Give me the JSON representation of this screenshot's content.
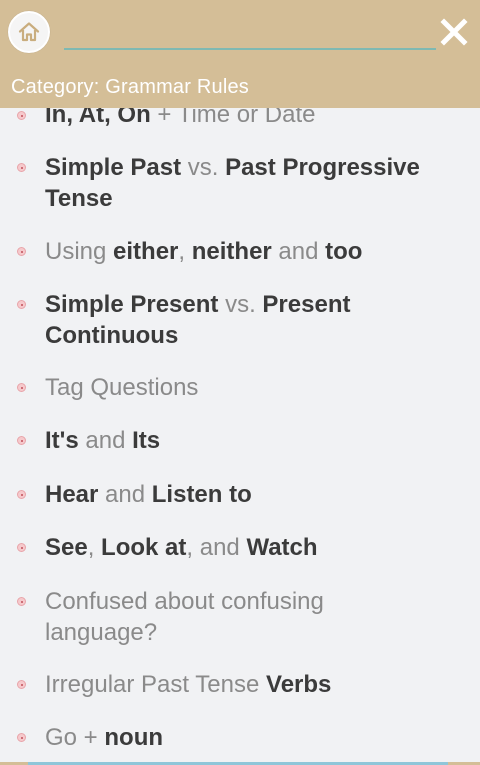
{
  "header": {
    "home_icon": "home-icon",
    "close_icon": "close-icon",
    "search_placeholder": "",
    "category_label": "Category: Grammar Rules",
    "background": "#d4be97"
  },
  "list": {
    "items": [
      {
        "segments": [
          {
            "text": "In, At, On",
            "bold": true
          },
          {
            "text": " + Time or Date",
            "bold": false
          }
        ]
      },
      {
        "segments": [
          {
            "text": "Simple Past",
            "bold": true
          },
          {
            "text": " vs. ",
            "bold": false
          },
          {
            "text": "Past Progressive Tense",
            "bold": true
          }
        ]
      },
      {
        "segments": [
          {
            "text": "Using ",
            "bold": false
          },
          {
            "text": "either",
            "bold": true
          },
          {
            "text": ", ",
            "bold": false
          },
          {
            "text": "neither",
            "bold": true
          },
          {
            "text": " and ",
            "bold": false
          },
          {
            "text": "too",
            "bold": true
          }
        ]
      },
      {
        "segments": [
          {
            "text": "Simple Present",
            "bold": true
          },
          {
            "text": " vs. ",
            "bold": false
          },
          {
            "text": "Present Continuous",
            "bold": true
          }
        ]
      },
      {
        "segments": [
          {
            "text": "Tag Questions",
            "bold": false
          }
        ]
      },
      {
        "segments": [
          {
            "text": "It's",
            "bold": true
          },
          {
            "text": " and ",
            "bold": false
          },
          {
            "text": "Its",
            "bold": true
          }
        ]
      },
      {
        "segments": [
          {
            "text": "Hear",
            "bold": true
          },
          {
            "text": " and ",
            "bold": false
          },
          {
            "text": "Listen to",
            "bold": true
          }
        ]
      },
      {
        "segments": [
          {
            "text": "See",
            "bold": true
          },
          {
            "text": ", ",
            "bold": false
          },
          {
            "text": "Look at",
            "bold": true
          },
          {
            "text": ", and ",
            "bold": false
          },
          {
            "text": "Watch",
            "bold": true
          }
        ]
      },
      {
        "segments": [
          {
            "text": "Confused about confusing language?",
            "bold": false
          }
        ]
      },
      {
        "segments": [
          {
            "text": "Irregular Past Tense ",
            "bold": false
          },
          {
            "text": "Verbs",
            "bold": true
          }
        ]
      },
      {
        "segments": [
          {
            "text": "Go",
            "bold": false
          },
          {
            "text": " + ",
            "bold": false
          },
          {
            "text": "noun",
            "bold": true
          }
        ]
      }
    ]
  }
}
